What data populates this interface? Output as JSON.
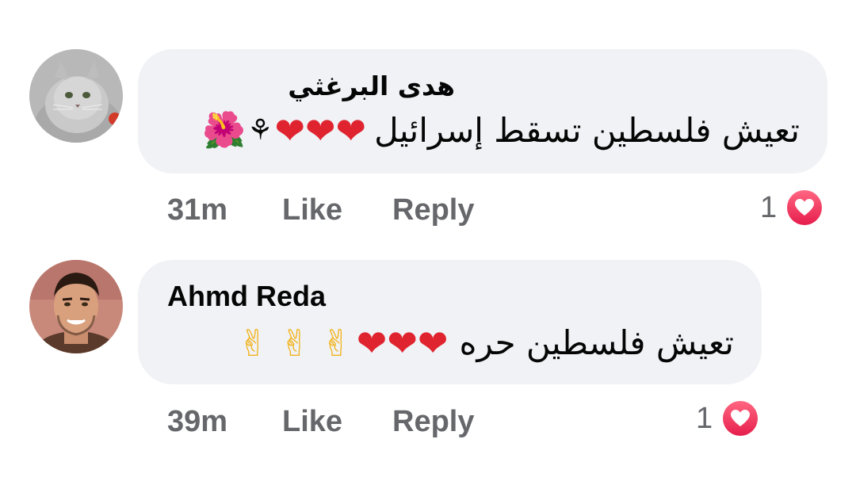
{
  "comments": [
    {
      "author": "هدى البرغثي",
      "text": "تعيش فلسطين تسقط إسرائيل",
      "emojis": "❤❤❤⚘🌺",
      "time": "31m",
      "like_label": "Like",
      "reply_label": "Reply",
      "reaction_count": "1",
      "reaction_icon": "heart-icon",
      "avatar": "cat-photo"
    },
    {
      "author": "Ahmd Reda",
      "text": "تعيش فلسطين حره",
      "emojis": "❤❤❤✌✌✌",
      "time": "39m",
      "like_label": "Like",
      "reply_label": "Reply",
      "reaction_count": "1",
      "reaction_icon": "heart-icon",
      "avatar": "man-photo"
    }
  ],
  "colors": {
    "bubble": "#f0f2f5",
    "meta_text": "#65676b",
    "heart": "#f33e58"
  }
}
